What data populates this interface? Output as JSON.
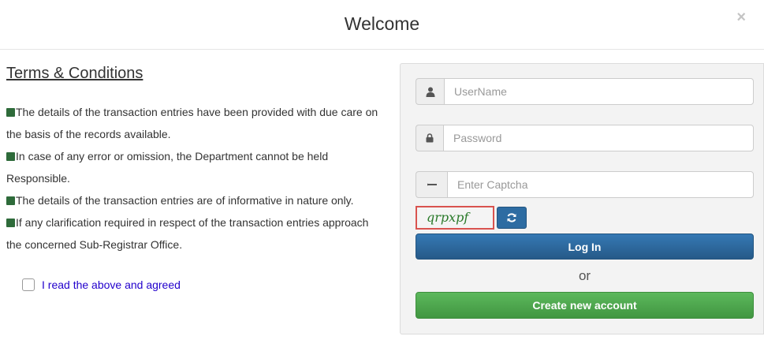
{
  "modal": {
    "title": "Welcome",
    "close_label": "×"
  },
  "terms": {
    "heading": "Terms & Conditions",
    "items": [
      "The details of the transaction entries have been provided with due care on the basis of the records available.",
      "In case of any error or omission, the Department cannot be held Responsible.",
      "The details of the transaction entries are of informative in nature only.",
      "If any clarification required in respect of the transaction entries approach the concerned Sub-Registrar Office."
    ],
    "agree_label": "I read the above and agreed"
  },
  "login": {
    "username_placeholder": "UserName",
    "password_placeholder": "Password",
    "captcha_placeholder": "Enter Captcha",
    "captcha_text": "qrpxpf",
    "login_label": "Log In",
    "or_label": "or",
    "create_label": "Create new account",
    "icons": {
      "user": "user-icon",
      "lock": "lock-icon",
      "pencil": "pencil-icon",
      "refresh": "refresh-icon"
    }
  }
}
